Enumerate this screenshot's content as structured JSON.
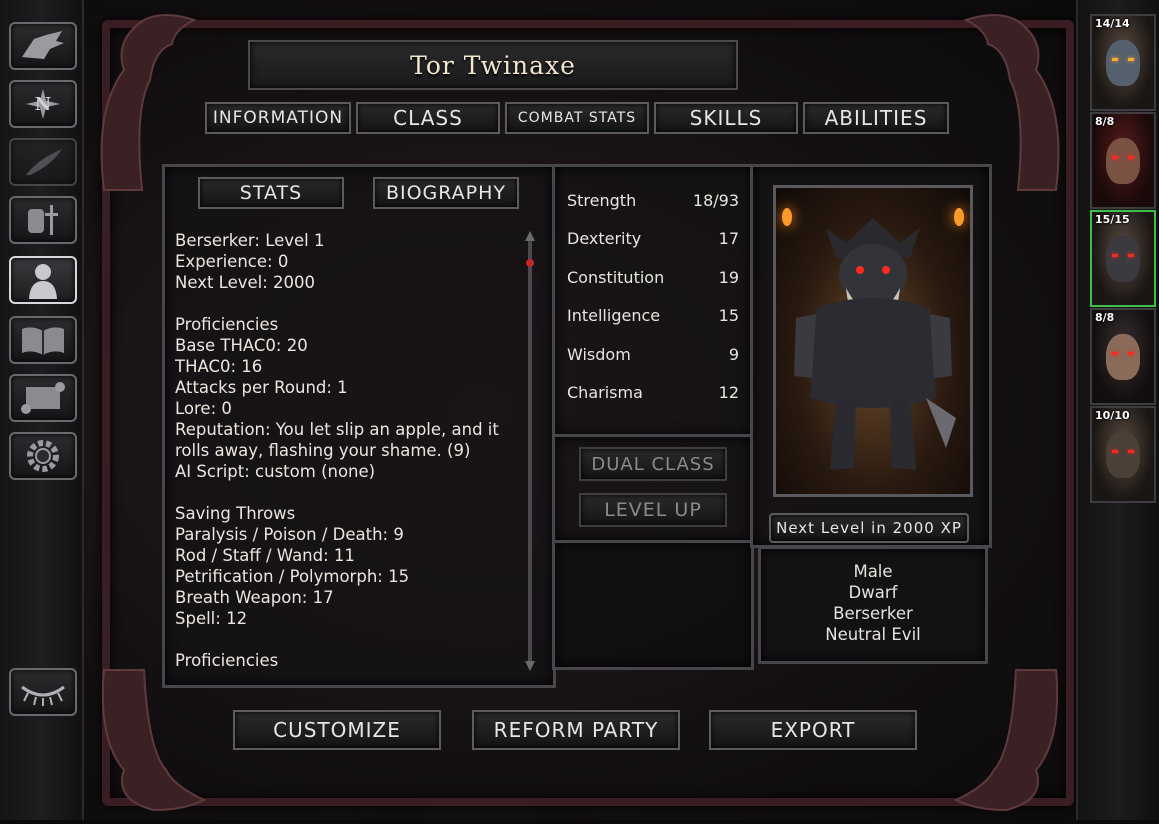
{
  "character": {
    "name": "Tor Twinaxe"
  },
  "tabs": [
    {
      "label": "INFORMATION"
    },
    {
      "label": "CLASS"
    },
    {
      "label": "COMBAT STATS"
    },
    {
      "label": "SKILLS"
    },
    {
      "label": "ABILITIES"
    }
  ],
  "subtabs": [
    {
      "label": "STATS"
    },
    {
      "label": "BIOGRAPHY"
    }
  ],
  "info_text": "Berserker: Level 1\nExperience: 0\nNext Level: 2000\n\nProficiencies\nBase THAC0: 20\nTHAC0: 16\nAttacks per Round: 1\nLore: 0\nReputation: You let slip an apple, and it rolls away, flashing your shame. (9)\nAI Script: custom (none)\n\nSaving Throws\nParalysis / Poison / Death: 9\nRod / Staff / Wand: 11\nPetrification / Polymorph: 15\nBreath Weapon: 17\nSpell: 12\n\nProficiencies",
  "abilities": [
    {
      "name": "Strength",
      "value": "18/93"
    },
    {
      "name": "Dexterity",
      "value": "17"
    },
    {
      "name": "Constitution",
      "value": "19"
    },
    {
      "name": "Intelligence",
      "value": "15"
    },
    {
      "name": "Wisdom",
      "value": "9"
    },
    {
      "name": "Charisma",
      "value": "12"
    }
  ],
  "buttons": {
    "dual_class": "DUAL CLASS",
    "level_up": "LEVEL UP",
    "customize": "CUSTOMIZE",
    "reform_party": "REFORM PARTY",
    "export": "EXPORT"
  },
  "next_level_xp": "Next Level in 2000 XP",
  "summary": [
    "Male",
    "Dwarf",
    "Berserker",
    "Neutral Evil"
  ],
  "party": [
    {
      "hp": "14/14",
      "selected": false
    },
    {
      "hp": "8/8",
      "selected": false
    },
    {
      "hp": "15/15",
      "selected": true
    },
    {
      "hp": "8/8",
      "selected": false
    },
    {
      "hp": "10/10",
      "selected": false
    }
  ],
  "left_rail": [
    {
      "icon": "dragon-icon"
    },
    {
      "icon": "compass-icon"
    },
    {
      "icon": "quill-icon"
    },
    {
      "icon": "inventory-icon"
    },
    {
      "icon": "character-icon"
    },
    {
      "icon": "spellbook-icon"
    },
    {
      "icon": "scroll-icon"
    },
    {
      "icon": "options-gear-icon"
    },
    {
      "icon": "rest-eye-icon"
    }
  ],
  "colors": {
    "selected_portrait": "#3fbf4a",
    "eye_red": "#ff2a1e",
    "frame_red": "#3a1d22"
  }
}
